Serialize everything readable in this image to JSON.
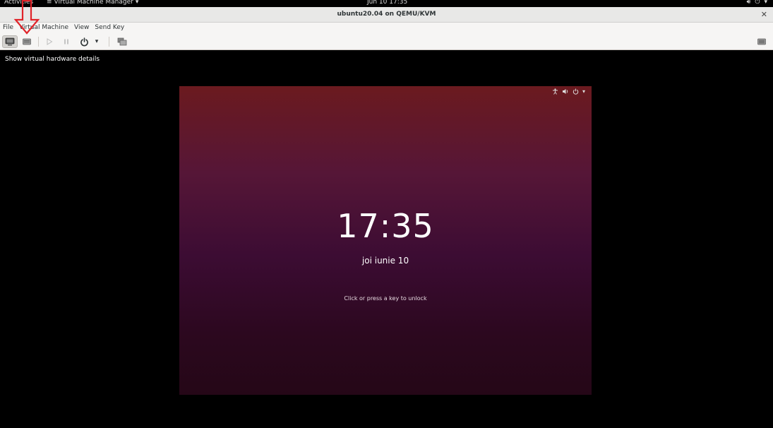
{
  "topbar": {
    "activities": "Activities",
    "app_name": "Virtual Machine Manager",
    "clock": "Jun 10  17:35"
  },
  "window": {
    "title": "ubuntu20.04 on QEMU/KVM"
  },
  "menubar": {
    "items": [
      "File",
      "Virtual Machine",
      "View",
      "Send Key"
    ]
  },
  "tooltip": {
    "text": "Show virtual hardware details"
  },
  "vm": {
    "time": "17:35",
    "date": "joi iunie 10",
    "hint": "Click or press a key to unlock"
  },
  "colors": {
    "annotation_arrow": "#e0242a",
    "vm_bg_top": "#6b1a1f",
    "vm_bg_bottom": "#250717"
  }
}
